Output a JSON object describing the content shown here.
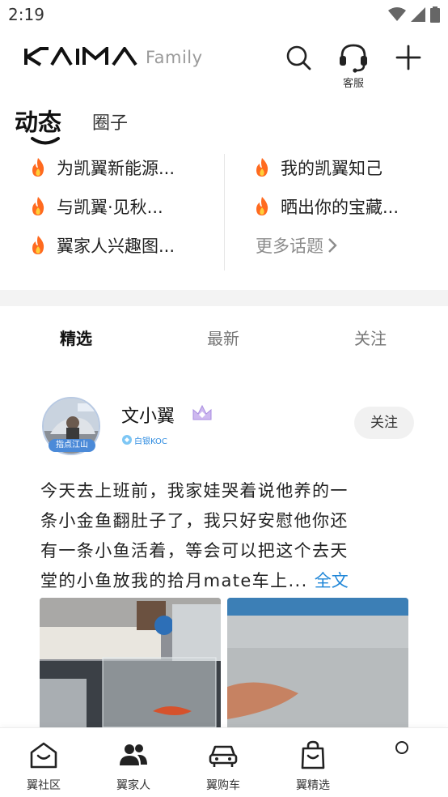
{
  "status_bar": {
    "time": "2:19"
  },
  "header": {
    "brand_suffix": "Family",
    "service_label": "客服",
    "icons": [
      "search-icon",
      "headset-icon",
      "plus-icon"
    ]
  },
  "main_tabs": {
    "active": "动态",
    "other": "圈子"
  },
  "topics": {
    "left": [
      "为凯翼新能源...",
      "与凯翼·见秋...",
      "翼家人兴趣图..."
    ],
    "right": [
      "我的凯翼知己",
      "晒出你的宝藏..."
    ],
    "more": "更多话题"
  },
  "feed_tabs": [
    "精选",
    "最新",
    "关注"
  ],
  "post": {
    "avatar_badge": "指点江山",
    "user_name": "文小翼",
    "user_tag": "白银KOC",
    "follow_label": "关注",
    "text_lines": [
      "今天去上班前，我家娃哭着说他养的一",
      "条小金鱼翻肚子了，我只好安慰他你还",
      "有一条小鱼活着，等会可以把这个去天",
      "堂的小鱼放我的拾月mate车上..."
    ],
    "full_text_link": "全文"
  },
  "bottom_nav": [
    "翼社区",
    "翼家人",
    "翼购车",
    "翼精选"
  ],
  "colors": {
    "link": "#1f86d8",
    "muted": "#8c8c8c",
    "band": "#f3f3f3"
  }
}
